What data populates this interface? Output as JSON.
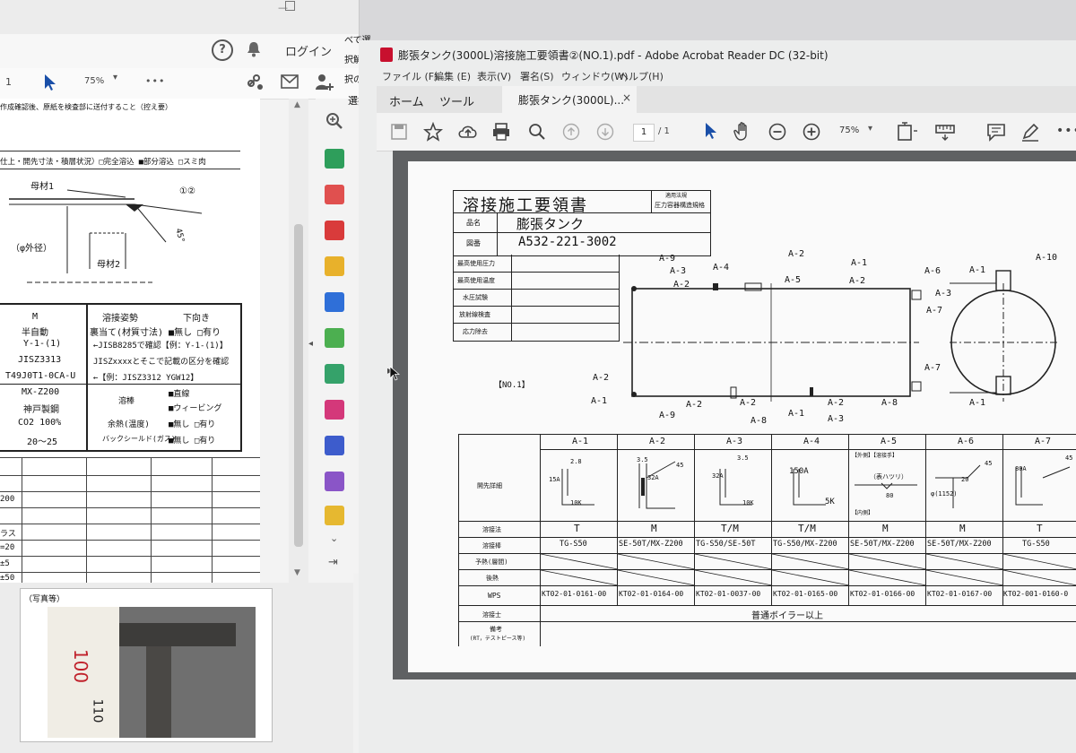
{
  "left_window": {
    "header": {
      "login_label": "ログイン"
    },
    "toolbar": {
      "page_num": "1",
      "zoom": "75%",
      "more": "•••"
    },
    "doc": {
      "line1": "作成確認後、原紙を検査部に送付すること（控え要）",
      "line2": "仕上・開先寸法・積層状況）□完全溶込 ■部分溶込 □スミ肉",
      "base_material_1": "母材1",
      "base_material_2": "母材2",
      "circle_labels": "①②",
      "diameter_label": "（φ外径）",
      "angle_label": "45°",
      "table": {
        "col1_header": "M",
        "col2_header": "溶接姿勢",
        "col3_header": "下向き",
        "rows_left": [
          "半自動",
          "Y-1-(1)",
          "JISZ3313",
          "T49J0T1-0CA-U",
          "MX-Z200",
          "神戸製鋼",
          "CO2 100%",
          "20～25"
        ],
        "row_backing": "裏当て(材質寸法) ■無し □有り",
        "row_jis1": "←JISB8285で確認【例：Y-1-(1)】",
        "row_jis2": "JISZxxxxとそこで記載の区分を確認",
        "row_jis3": "←【例：JISZ3312 YGW12】",
        "flux_label": "溶棒",
        "flux_val1": "■直線",
        "flux_val2": "■ウィービング",
        "preheat_label": "余熱(温度)",
        "preheat_val": "■無し □有り",
        "backgas_label": "バックシールド(ガス)",
        "backgas_val": "■無し □有り"
      },
      "lower_left": [
        "200",
        "ラス",
        "=20",
        "±5",
        "±50"
      ]
    },
    "photo": {
      "label": "（写真等）",
      "ruler_100": "100",
      "ruler_110": "110"
    }
  },
  "right_window": {
    "partial_left_text": [
      "べて選",
      "択解除",
      "択の切",
      "選択"
    ],
    "title": "膨張タンク(3000L)溶接施工要領書②(NO.1).pdf - Adobe Acrobat Reader DC (32-bit)",
    "menus": [
      "ファイル (F)",
      "編集 (E)",
      "表示(V)",
      "署名(S)",
      "ウィンドウ(W)",
      "ヘルプ(H)"
    ],
    "tabs": [
      "ホーム",
      "ツール"
    ],
    "active_tab": "膨張タンク(3000L)...",
    "page_current": "1",
    "page_total": "/ 1",
    "zoom": "75%"
  },
  "drawing": {
    "title": "溶接施工要領書",
    "applicable_law_label": "適用法規",
    "applicable_law_value": "圧力容器構造規格",
    "product_label": "品名",
    "product_value": "膨張タンク",
    "drawing_no_label": "図番",
    "drawing_no_value": "A532-221-3002",
    "spec_rows": [
      "最高使用圧力",
      "最高使用温度",
      "水圧試験",
      "放射線検査",
      "応力除去"
    ],
    "no_label": "【NO.1】",
    "callouts": [
      "A-9",
      "A-3",
      "A-2",
      "A-4",
      "A-2",
      "A-5",
      "A-1",
      "A-2",
      "A-6",
      "A-3",
      "A-7",
      "A-1",
      "A-10",
      "A-2",
      "A-1",
      "A-9",
      "A-2",
      "A-8",
      "A-2",
      "A-1",
      "A-2",
      "A-3",
      "A-8",
      "A-7",
      "A-1"
    ],
    "table": {
      "columns": [
        "A-1",
        "A-2",
        "A-3",
        "A-4",
        "A-5",
        "A-6",
        "A-7"
      ],
      "groove_label": "開先詳細",
      "groove_notes": [
        "2.8",
        "15A",
        "10K",
        "3.5",
        "32A",
        "45",
        "3.5",
        "32A",
        "10K",
        "150A",
        "5K",
        "【外側】【溶接手】",
        "（表ハツリ）",
        "80",
        "【内側】",
        "45",
        "φ(1152)",
        "20",
        "80A",
        "45"
      ],
      "method_label": "溶接法",
      "methods": [
        "T",
        "M",
        "T/M",
        "T/M",
        "M",
        "M",
        "T"
      ],
      "rod_label": "溶接棒",
      "rods": [
        "TG-S50",
        "SE-50T/MX-Z200",
        "TG-S50/SE-50T",
        "TG-S50/MX-Z200",
        "SE-50T/MX-Z200",
        "SE-50T/MX-Z200",
        "TG-S50"
      ],
      "preheat_label": "予熱(層間)",
      "postheat_label": "後熱",
      "wps_label": "WPS",
      "wps": [
        "KT02-01-0161-00",
        "KT02-01-0164-00",
        "KT02-01-0037-00",
        "KT02-01-0165-00",
        "KT02-01-0166-00",
        "KT02-01-0167-00",
        "KT02-001-0160-0"
      ],
      "welder_label": "溶接士",
      "welder_value": "普通ボイラー以上",
      "remarks_label": "備考",
      "remarks_sub": "(RT，テストピース等)"
    }
  },
  "colors": {
    "acrobat_red": "#c8102e",
    "accent_blue": "#2a5fb8",
    "doc_bg": "#5f6163"
  }
}
